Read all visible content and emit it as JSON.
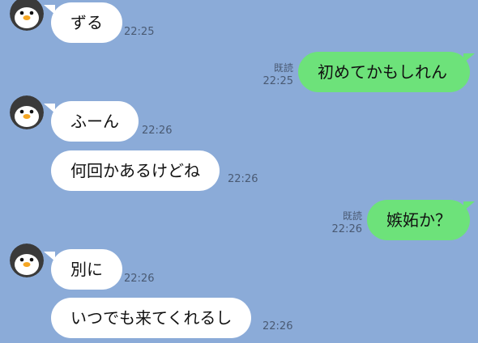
{
  "colors": {
    "background": "#8BABD8",
    "incoming_bubble": "#FFFFFF",
    "outgoing_bubble": "#6DE27A",
    "meta_text": "#4A5A73"
  },
  "messages": [
    {
      "direction": "in",
      "avatar_icon": "penguin-icon",
      "text": "ずる",
      "time": "22:25"
    },
    {
      "direction": "out",
      "text": "初めてかもしれん",
      "read": "既読",
      "time": "22:25"
    },
    {
      "direction": "in",
      "avatar_icon": "penguin-icon",
      "text": "ふーん",
      "time": "22:26"
    },
    {
      "direction": "in",
      "text": "何回かあるけどね",
      "time": "22:26"
    },
    {
      "direction": "out",
      "text": "嫉妬か？",
      "read": "既読",
      "time": "22:26"
    },
    {
      "direction": "in",
      "avatar_icon": "penguin-icon",
      "text": "別に",
      "time": "22:26"
    },
    {
      "direction": "in",
      "text": "いつでも来てくれるし",
      "time": "22:26"
    }
  ]
}
